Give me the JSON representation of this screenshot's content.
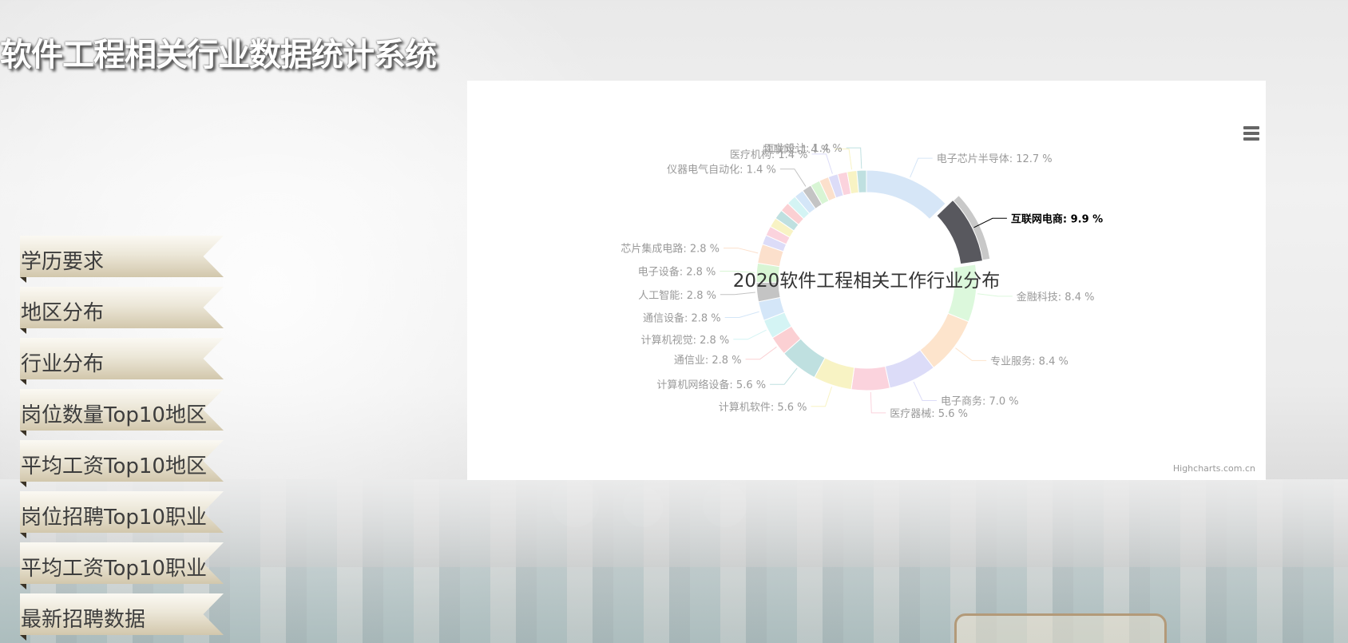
{
  "page": {
    "title": "软件工程相关行业数据统计系统"
  },
  "nav": {
    "items": [
      {
        "label": "学历要求"
      },
      {
        "label": "地区分布"
      },
      {
        "label": "行业分布"
      },
      {
        "label": "岗位数量Top10地区"
      },
      {
        "label": "平均工资Top10地区"
      },
      {
        "label": "岗位招聘Top10职业"
      },
      {
        "label": "平均工资Top10职业"
      },
      {
        "label": "最新招聘数据"
      }
    ]
  },
  "chart": {
    "credits": "Highcharts.com.cn",
    "menu_icon": "hamburger-menu-icon"
  },
  "chart_data": {
    "type": "pie",
    "title": "2020软件工程相关工作行业分布",
    "inner_size": "donut",
    "selected": "互联网电商",
    "slices": [
      {
        "name": "电子芯片半导体",
        "value": 12.7,
        "color": "#d6e6f7",
        "label": "电子芯片半导体: 12.7 %"
      },
      {
        "name": "互联网电商",
        "value": 9.9,
        "color": "#58585e",
        "label": "互联网电商: 9.9 %"
      },
      {
        "name": "金融科技",
        "value": 8.4,
        "color": "#dcf8dc",
        "label": "金融科技: 8.4 %"
      },
      {
        "name": "专业服务",
        "value": 8.4,
        "color": "#fde4cc",
        "label": "专业服务: 8.4 %"
      },
      {
        "name": "电子商务",
        "value": 7.0,
        "color": "#dcdcf8",
        "label": "电子商务: 7.0 %"
      },
      {
        "name": "医疗器械",
        "value": 5.6,
        "color": "#fbd3dd",
        "label": "医疗器械: 5.6 %"
      },
      {
        "name": "计算机软件",
        "value": 5.6,
        "color": "#f8f3c4",
        "label": "计算机软件: 5.6 %"
      },
      {
        "name": "计算机网络设备",
        "value": 5.6,
        "color": "#bfe0e0",
        "label": "计算机网络设备: 5.6 %"
      },
      {
        "name": "通信业",
        "value": 2.8,
        "color": "#fbd0d3",
        "label": "通信业: 2.8 %"
      },
      {
        "name": "计算机视觉",
        "value": 2.8,
        "color": "#d4f4f4",
        "label": "计算机视觉: 2.8 %"
      },
      {
        "name": "通信设备",
        "value": 2.8,
        "color": "#d4e6f8",
        "label": "通信设备: 2.8 %"
      },
      {
        "name": "人工智能",
        "value": 2.8,
        "color": "#c4c4c4",
        "label": "人工智能: 2.8 %"
      },
      {
        "name": "电子设备",
        "value": 2.8,
        "color": "#d8f5d4",
        "label": "电子设备: 2.8 %"
      },
      {
        "name": "芯片集成电路",
        "value": 2.8,
        "color": "#fce0cc",
        "label": "芯片集成电路: 2.8 %"
      },
      {
        "name": "",
        "value": 1.4,
        "color": "#dcdcf8",
        "label": ""
      },
      {
        "name": "",
        "value": 1.4,
        "color": "#fbd3dd",
        "label": ""
      },
      {
        "name": "",
        "value": 1.4,
        "color": "#f8f3c4",
        "label": ""
      },
      {
        "name": "",
        "value": 1.4,
        "color": "#bfe0e0",
        "label": ""
      },
      {
        "name": "",
        "value": 1.4,
        "color": "#fbd0d3",
        "label": ""
      },
      {
        "name": "",
        "value": 1.4,
        "color": "#d4f4f4",
        "label": ""
      },
      {
        "name": "",
        "value": 1.4,
        "color": "#d4e6f8",
        "label": ""
      },
      {
        "name": "仪器电气自动化",
        "value": 1.4,
        "color": "#c4c4c4",
        "label": "仪器电气自动化: 1.4 %"
      },
      {
        "name": "",
        "value": 1.4,
        "color": "#d8f5d4",
        "label": ""
      },
      {
        "name": "",
        "value": 1.4,
        "color": "#fce0cc",
        "label": ""
      },
      {
        "name": "医疗机构",
        "value": 1.4,
        "color": "#dcdcf8",
        "label": "医疗机构: 1.4 %"
      },
      {
        "name": "",
        "value": 1.4,
        "color": "#fbd3dd",
        "label": ""
      },
      {
        "name": "物联网",
        "value": 1.4,
        "color": "#f8f3c4",
        "label": "物联网: 1.4 %"
      },
      {
        "name": "工业设计",
        "value": 1.4,
        "color": "#bfe0e0",
        "label": "工业设计: 1.4 %"
      }
    ]
  }
}
